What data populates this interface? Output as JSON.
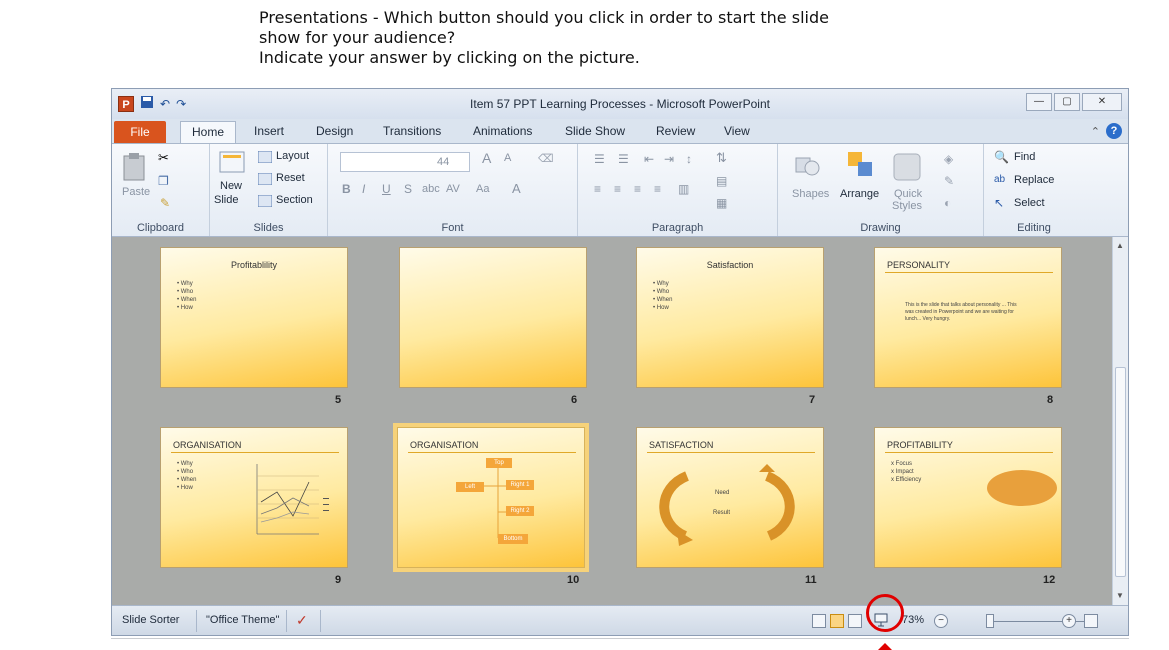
{
  "question": {
    "line1": "Presentations - Which button should you click in order to start the slide",
    "line2": "show for your audience?",
    "line3": "Indicate your answer by clicking on the picture."
  },
  "window": {
    "title": "Item 57 PPT Learning Processes - Microsoft PowerPoint",
    "app_logo": "P"
  },
  "tabs": [
    "File",
    "Home",
    "Insert",
    "Design",
    "Transitions",
    "Animations",
    "Slide Show",
    "Review",
    "View"
  ],
  "ribbon": {
    "clipboard": {
      "paste": "Paste",
      "label": "Clipboard"
    },
    "slides": {
      "new_slide_1": "New",
      "new_slide_2": "Slide",
      "layout": "Layout",
      "reset": "Reset",
      "section": "Section",
      "label": "Slides"
    },
    "font": {
      "size": "44",
      "grow": "A",
      "shrink": "A",
      "bold": "B",
      "italic": "I",
      "underline": "U",
      "strike": "S",
      "abc": "abc",
      "spacing": "AV",
      "case": "Aa",
      "color": "A",
      "label": "Font"
    },
    "paragraph": {
      "label": "Paragraph"
    },
    "drawing": {
      "shapes": "Shapes",
      "arrange": "Arrange",
      "quick_styles_1": "Quick",
      "quick_styles_2": "Styles",
      "label": "Drawing"
    },
    "editing": {
      "find": "Find",
      "replace": "Replace",
      "select": "Select",
      "label": "Editing"
    }
  },
  "slides": [
    {
      "num": "5",
      "title": "Profitablility",
      "bullets": [
        "• Why",
        "• Who",
        "• When",
        "• How"
      ]
    },
    {
      "num": "6",
      "title": "",
      "bullets": []
    },
    {
      "num": "7",
      "title": "Satisfaction",
      "bullets": [
        "• Why",
        "• Who",
        "• When",
        "• How"
      ]
    },
    {
      "num": "8",
      "title": "PERSONALITY",
      "body": "This is the slide that talks about personality ... This was created in Powerpoint and we are waiting for lunch... Very hungry."
    },
    {
      "num": "9",
      "title": "ORGANISATION",
      "bullets": [
        "• Why",
        "• Who",
        "• When",
        "• How"
      ]
    },
    {
      "num": "10",
      "title": "ORGANISATION",
      "org": {
        "top": "Top",
        "left": "Left",
        "right1": "Right 1",
        "right2": "Right 2",
        "bottom": "Bottom"
      }
    },
    {
      "num": "11",
      "title": "SATISFACTION",
      "cycle": {
        "need": "Need",
        "result": "Result"
      }
    },
    {
      "num": "12",
      "title": "PROFITABILITY",
      "bullets": [
        "x Focus",
        "x Impact",
        "x Efficiency"
      ]
    }
  ],
  "status": {
    "view": "Slide Sorter",
    "theme": "\"Office Theme\"",
    "zoom": "73%"
  },
  "colors": {
    "file_tab": "#d9541e",
    "highlight_circle": "#e00000",
    "slide_gold": "#fdc43a"
  },
  "icons": [
    "save-icon",
    "undo-icon",
    "redo-icon",
    "help-icon",
    "normal-view-icon",
    "slide-sorter-icon",
    "reading-view-icon",
    "slide-show-icon",
    "zoom-out-icon",
    "zoom-in-icon",
    "fit-window-icon"
  ]
}
